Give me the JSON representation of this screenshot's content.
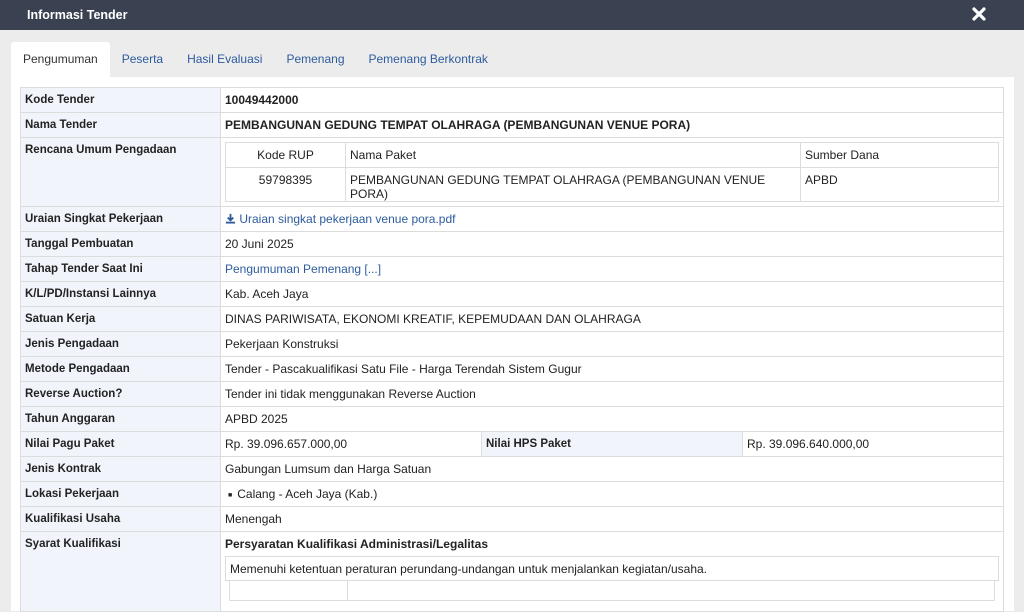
{
  "window": {
    "title": "Informasi Tender",
    "close_icon": "close-icon"
  },
  "tabs": [
    {
      "label": "Pengumuman",
      "active": true
    },
    {
      "label": "Peserta",
      "active": false
    },
    {
      "label": "Hasil Evaluasi",
      "active": false
    },
    {
      "label": "Pemenang",
      "active": false
    },
    {
      "label": "Pemenang Berkontrak",
      "active": false
    }
  ],
  "info": {
    "kode_tender": {
      "label": "Kode Tender",
      "value": "10049442000"
    },
    "nama_tender": {
      "label": "Nama Tender",
      "value": "PEMBANGUNAN GEDUNG TEMPAT OLAHRAGA (PEMBANGUNAN VENUE PORA)"
    },
    "rup": {
      "label": "Rencana Umum Pengadaan",
      "headers": [
        "Kode RUP",
        "Nama Paket",
        "Sumber Dana"
      ],
      "row": [
        "59798395",
        "PEMBANGUNAN GEDUNG TEMPAT OLAHRAGA (PEMBANGUNAN VENUE PORA)",
        "APBD"
      ]
    },
    "uraian": {
      "label": "Uraian Singkat Pekerjaan",
      "value": "Uraian singkat pekerjaan venue pora.pdf",
      "icon": "download-icon"
    },
    "tanggal": {
      "label": "Tanggal Pembuatan",
      "value": "20 Juni 2025"
    },
    "tahap": {
      "label": "Tahap Tender Saat Ini",
      "value": "Pengumuman Pemenang [...]"
    },
    "klpd": {
      "label": "K/L/PD/Instansi Lainnya",
      "value": "Kab. Aceh Jaya"
    },
    "satker": {
      "label": "Satuan Kerja",
      "value": "DINAS PARIWISATA, EKONOMI KREATIF, KEPEMUDAAN DAN OLAHRAGA"
    },
    "jenis_pengadaan": {
      "label": "Jenis Pengadaan",
      "value": "Pekerjaan Konstruksi"
    },
    "metode": {
      "label": "Metode Pengadaan",
      "value": "Tender - Pascakualifikasi Satu File - Harga Terendah Sistem Gugur"
    },
    "reverse": {
      "label": "Reverse Auction?",
      "value": "Tender ini tidak menggunakan Reverse Auction"
    },
    "tahun": {
      "label": "Tahun Anggaran",
      "value": "APBD 2025"
    },
    "pagu": {
      "label": "Nilai Pagu Paket",
      "value": "Rp. 39.096.657.000,00"
    },
    "hps": {
      "label": "Nilai HPS Paket",
      "value": "Rp. 39.096.640.000,00"
    },
    "kontrak": {
      "label": "Jenis Kontrak",
      "value": "Gabungan Lumsum dan Harga Satuan"
    },
    "lokasi": {
      "label": "Lokasi Pekerjaan",
      "items": [
        "Calang - Aceh Jaya (Kab.)"
      ]
    },
    "kualifikasi": {
      "label": "Kualifikasi Usaha",
      "value": "Menengah"
    },
    "syarat": {
      "label": "Syarat Kualifikasi",
      "heading": "Persyaratan Kualifikasi Administrasi/Legalitas",
      "text": "Memenuhi ketentuan peraturan perundang-undangan untuk menjalankan kegiatan/usaha."
    }
  },
  "colors": {
    "titlebar": "#3a4252",
    "link": "#2d5b9e",
    "label_bg": "#f1f5fb"
  }
}
